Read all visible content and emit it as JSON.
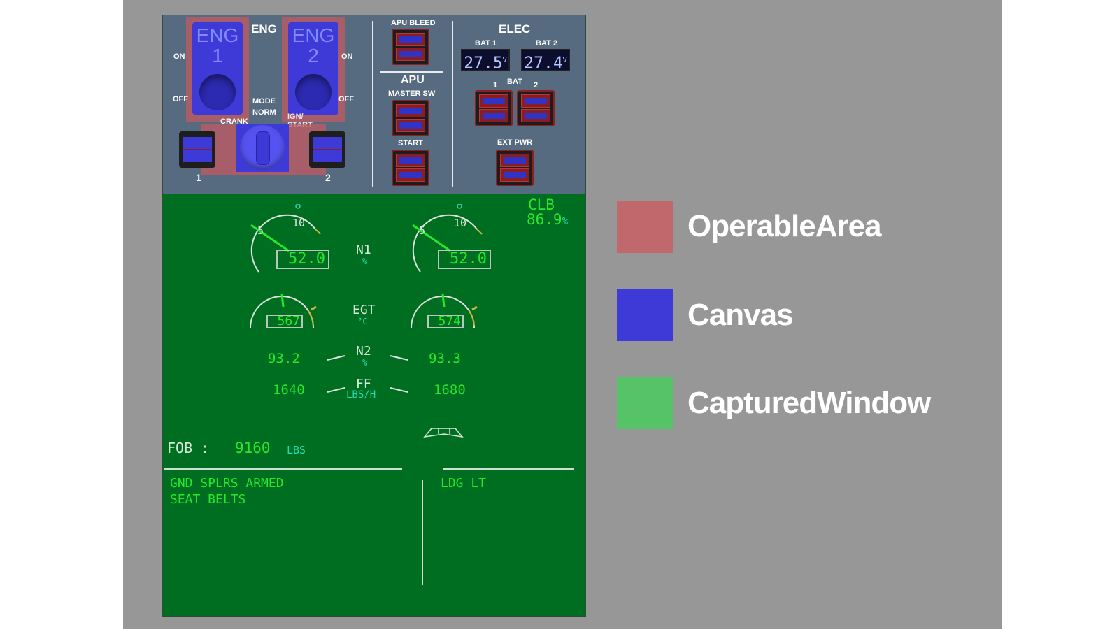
{
  "overhead": {
    "eng_title": "ENG",
    "eng1": {
      "line1": "ENG",
      "line2": "1"
    },
    "eng2": {
      "line1": "ENG",
      "line2": "2"
    },
    "on_label": "ON",
    "off_label": "OFF",
    "mode": {
      "title": "MODE",
      "norm": "NORM",
      "crank": "CRANK",
      "ign_line1": "IGN/",
      "ign_line2": "START"
    },
    "crank1": "1",
    "crank2": "2",
    "apu_bleed": "APU BLEED",
    "apu_title": "APU",
    "master_sw": "MASTER SW",
    "start": "START",
    "elec_title": "ELEC",
    "bat1_label": "BAT 1",
    "bat2_label": "BAT 2",
    "bat1_value": "27.5",
    "bat2_value": "27.4",
    "volt_unit": "V",
    "bat_label": "BAT",
    "bat_num1": "1",
    "bat_num2": "2",
    "ext_pwr": "EXT PWR"
  },
  "ecam": {
    "mode": "CLB",
    "thrust_limit": "86.9",
    "thrust_unit": "%",
    "n1_label": "N1",
    "pct": "%",
    "n1_left": "52.0",
    "n1_right": "52.0",
    "dial_5": "5",
    "dial_10": "10",
    "egt_label": "EGT",
    "egt_unit": "°C",
    "egt_left": "567",
    "egt_right": "574",
    "n2_label": "N2",
    "n2_left": "93.2",
    "n2_right": "93.3",
    "ff_label": "FF",
    "ff_unit": "LBS/H",
    "ff_left": "1640",
    "ff_right": "1680",
    "fob_label": "FOB :",
    "fob_value": "9160",
    "fob_unit": "LBS",
    "memo_left": [
      "GND SPLRS ARMED",
      "SEAT BELTS"
    ],
    "memo_right": [
      "LDG LT"
    ]
  },
  "legend": [
    {
      "label": "OperableArea",
      "color": "#c0686c"
    },
    {
      "label": "Canvas",
      "color": "#3d3ad8"
    },
    {
      "label": "CapturedWindow",
      "color": "#57c368"
    }
  ]
}
